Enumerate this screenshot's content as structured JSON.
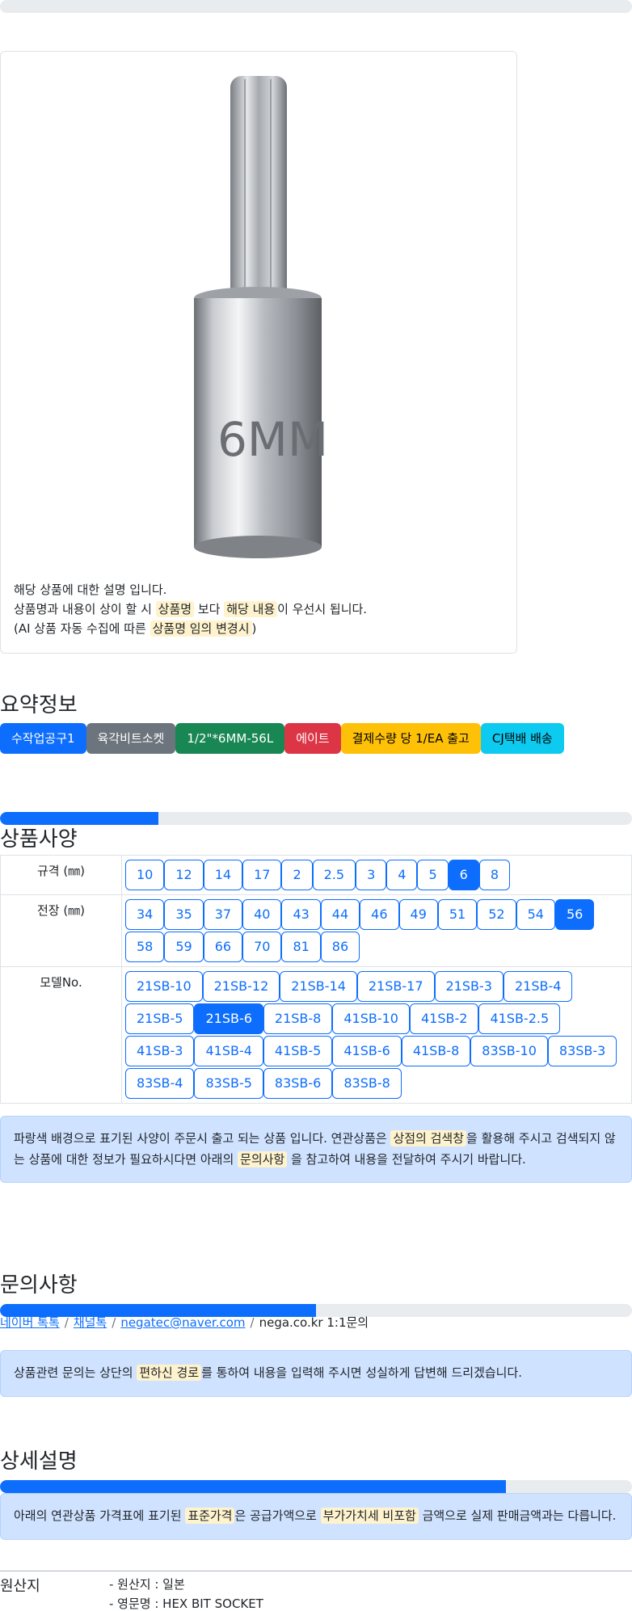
{
  "top_progress": {
    "value_percent": 0
  },
  "product": {
    "image_label": "6MM",
    "desc_line1": "해당 상품에 대한 설명 입니다.",
    "desc_line2_a": "상품명과 내용이 상이 할 시 ",
    "desc_line2_hl1": "상품명",
    "desc_line2_b": " 보다 ",
    "desc_line2_hl2": "해당 내용",
    "desc_line2_c": "이 우선시 됩니다.",
    "desc_line3_a": "(AI 상품 자동 수집에 따른 ",
    "desc_line3_hl": "상품명 임의 변경시",
    "desc_line3_b": ")"
  },
  "summary": {
    "title": "요약정보",
    "badges": [
      {
        "label": "수작업공구1",
        "color": "#0d6efd"
      },
      {
        "label": "육각비트소켓",
        "color": "#6c757d"
      },
      {
        "label": "1/2\"*6MM-56L",
        "color": "#198754"
      },
      {
        "label": "에이트",
        "color": "#dc3545"
      },
      {
        "label": "결제수량 당 1/EA 출고",
        "color": "#ffc107"
      },
      {
        "label": "CJ택배 배송",
        "color": "#0dcaf0"
      }
    ]
  },
  "spec": {
    "progress_percent": 25,
    "title": "상품사양",
    "rows": [
      {
        "key": "규격 (㎜)",
        "values": [
          "10",
          "12",
          "14",
          "17",
          "2",
          "2.5",
          "3",
          "4",
          "5",
          "6",
          "8"
        ],
        "active": "6"
      },
      {
        "key": "전장 (㎜)",
        "values": [
          "34",
          "35",
          "37",
          "40",
          "43",
          "44",
          "46",
          "49",
          "51",
          "52",
          "54",
          "56",
          "58",
          "59",
          "66",
          "70",
          "81",
          "86"
        ],
        "active": "56"
      },
      {
        "key": "모델No.",
        "values": [
          "21SB-10",
          "21SB-12",
          "21SB-14",
          "21SB-17",
          "21SB-3",
          "21SB-4",
          "21SB-5",
          "21SB-6",
          "21SB-8",
          "41SB-10",
          "41SB-2",
          "41SB-2.5",
          "41SB-3",
          "41SB-4",
          "41SB-5",
          "41SB-6",
          "41SB-8",
          "83SB-10",
          "83SB-3",
          "83SB-4",
          "83SB-5",
          "83SB-6",
          "83SB-8"
        ],
        "active": "21SB-6"
      }
    ],
    "notice_a": "파랑색 배경으로 표기된 사양이 주문시 출고 되는 상품 입니다. 연관상품은 ",
    "notice_hl1": "상점의 검색창",
    "notice_b": "을 활용해 주시고 검색되지 않는 상품에 대한 정보가 필요하시다면 아래의 ",
    "notice_hl2": "문의사항",
    "notice_c": " 을 참고하여 내용을 전달하여 주시기 바랍니다."
  },
  "inquiry": {
    "title": "문의사항",
    "progress_percent": 50,
    "links": [
      "네이버 톡톡",
      "채널톡",
      "negatec@naver.com"
    ],
    "plain": "nega.co.kr 1:1문의",
    "sep": "/",
    "notice_a": "상품관련 문의는 상단의 ",
    "notice_hl": "편하신 경로",
    "notice_b": "를 통하여 내용을 입력해 주시면 성실하게 답변해 드리겠습니다."
  },
  "detail": {
    "title": "상세설명",
    "progress_percent": 80,
    "notice_a": "아래의 연관상품 가격표에 표기된 ",
    "notice_hl1": "표준가격",
    "notice_b": "은 공급가액으로 ",
    "notice_hl2": "부가가치세 비포함",
    "notice_c": " 금액으로 실제 판매금액과는 다릅니다."
  },
  "origin": {
    "label": "원산지",
    "items": [
      "- 원산지 : 일본",
      "- 영문명 : HEX BIT SOCKET"
    ]
  }
}
